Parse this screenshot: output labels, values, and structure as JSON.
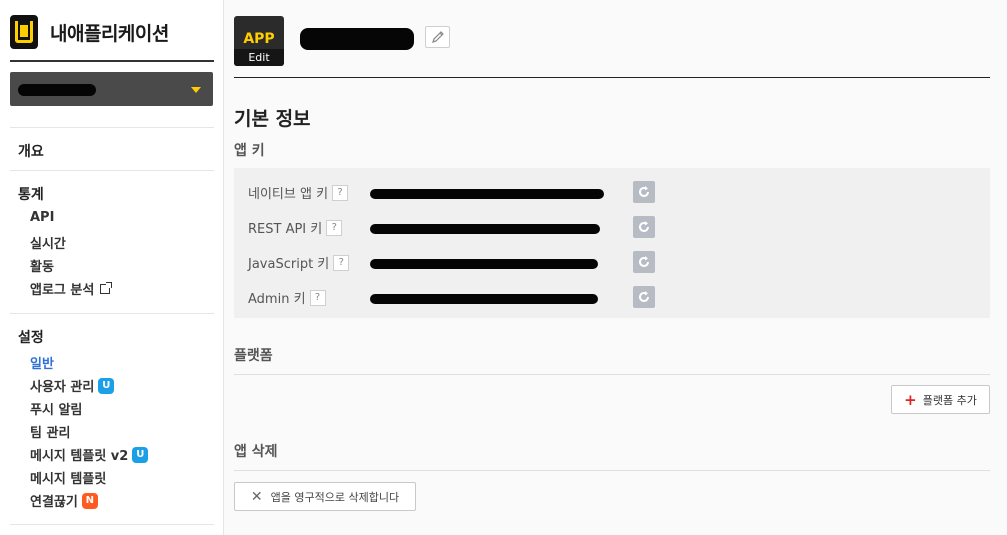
{
  "brand": {
    "title": "내애플리케이션"
  },
  "sidebar": {
    "overview": "개요",
    "stats": {
      "heading": "통계",
      "items": [
        {
          "label": "API"
        },
        {
          "label": "실시간"
        },
        {
          "label": "활동"
        },
        {
          "label": "앱로그 분석"
        }
      ]
    },
    "settings": {
      "heading": "설정",
      "items": [
        {
          "label": "일반"
        },
        {
          "label": "사용자 관리",
          "badge": "U"
        },
        {
          "label": "푸시 알림"
        },
        {
          "label": "팀 관리"
        },
        {
          "label": "메시지 템플릿 v2",
          "badge": "U"
        },
        {
          "label": "메시지 템플릿"
        },
        {
          "label": "연결끊기",
          "badge": "N"
        }
      ]
    }
  },
  "header": {
    "icon_label": "APP",
    "icon_edit": "Edit"
  },
  "main": {
    "section_title": "기본 정보",
    "app_key_heading": "앱 키",
    "help_mark": "?",
    "keys": [
      {
        "label": "네이티브 앱 키"
      },
      {
        "label": "REST API 키"
      },
      {
        "label": "JavaScript 키"
      },
      {
        "label": "Admin 키"
      }
    ],
    "platform_heading": "플랫폼",
    "add_platform_label": "플랫폼 추가",
    "add_platform_plus": "+",
    "delete_heading": "앱 삭제",
    "delete_label": "앱을 영구적으로 삭제합니다",
    "delete_x": "✕"
  },
  "colors": {
    "accent": "#ffcd00",
    "active_link": "#2e6fd8",
    "badge_u": "#1aa0e6",
    "badge_n": "#ff5a1f",
    "plus": "#e02424"
  }
}
